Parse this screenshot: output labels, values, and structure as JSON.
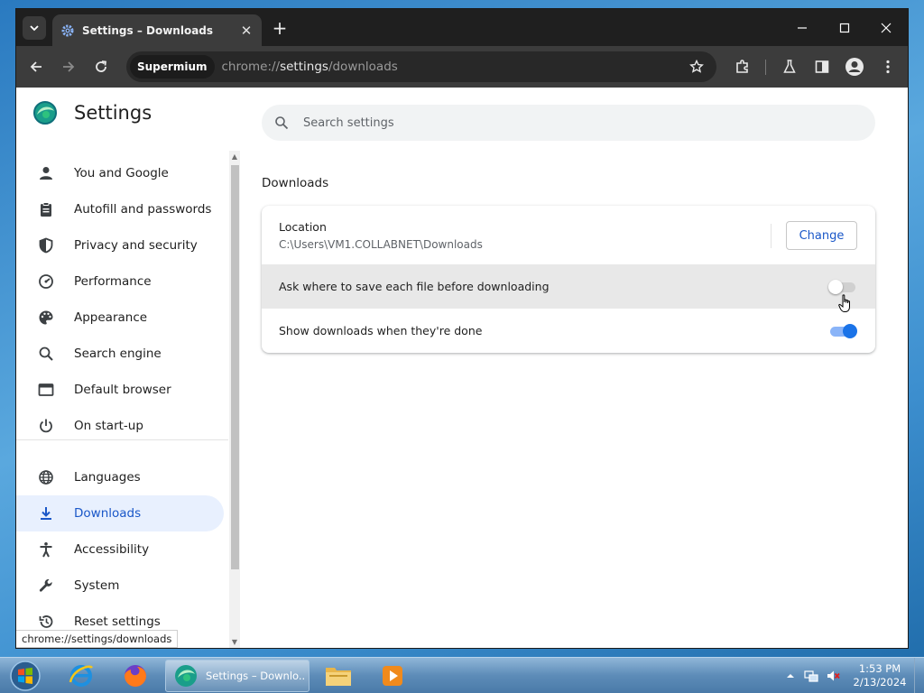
{
  "browser": {
    "tab_title": "Settings – Downloads",
    "tab_close_glyph": "✕",
    "new_tab_glyph": "+",
    "omnibox_chip": "Supermium",
    "url_scheme": "chrome://",
    "url_host": "settings",
    "url_path": "/downloads"
  },
  "settings": {
    "title": "Settings",
    "search_placeholder": "Search settings",
    "nav": [
      {
        "label": "You and Google",
        "icon": "person-icon"
      },
      {
        "label": "Autofill and passwords",
        "icon": "clipboard-icon"
      },
      {
        "label": "Privacy and security",
        "icon": "shield-icon"
      },
      {
        "label": "Performance",
        "icon": "speedometer-icon"
      },
      {
        "label": "Appearance",
        "icon": "palette-icon"
      },
      {
        "label": "Search engine",
        "icon": "search-icon"
      },
      {
        "label": "Default browser",
        "icon": "browser-window-icon"
      },
      {
        "label": "On start-up",
        "icon": "power-icon"
      },
      {
        "label": "Languages",
        "icon": "globe-icon"
      },
      {
        "label": "Downloads",
        "icon": "download-icon",
        "active": true
      },
      {
        "label": "Accessibility",
        "icon": "accessibility-icon"
      },
      {
        "label": "System",
        "icon": "wrench-icon"
      },
      {
        "label": "Reset settings",
        "icon": "reset-history-icon"
      }
    ],
    "section_title": "Downloads",
    "location": {
      "label": "Location",
      "path": "C:\\Users\\VM1.COLLABNET\\Downloads",
      "change_button": "Change"
    },
    "ask_where_to_save": {
      "label": "Ask where to save each file before downloading",
      "enabled": false
    },
    "show_downloads_when_done": {
      "label": "Show downloads when they're done",
      "enabled": true
    },
    "status_url": "chrome://settings/downloads"
  },
  "taskbar": {
    "active_task_label": "Settings – Downlo...",
    "clock_time": "1:53 PM",
    "clock_date": "2/13/2024"
  },
  "colors": {
    "accent": "#1a73e8",
    "active_nav_bg": "#e8f0fe",
    "active_nav_text": "#1a57c8",
    "titlebar": "#1f1f1f",
    "toolbar": "#3c3c3c"
  }
}
